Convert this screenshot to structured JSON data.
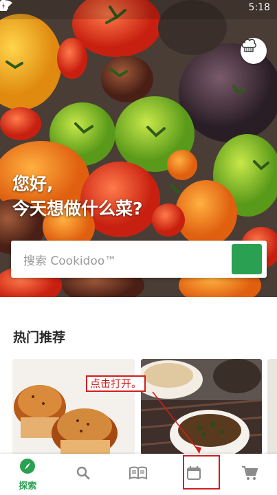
{
  "status_bar": {
    "time": "5:18"
  },
  "hero": {
    "greeting_line1": "您好,",
    "greeting_line2": "今天想做什么菜?"
  },
  "search": {
    "placeholder": "搜索 Cookidoo™"
  },
  "section": {
    "title": "热门推荐"
  },
  "annotation": {
    "label": "点击打开。"
  },
  "nav": {
    "explore_label": "探索",
    "active_color": "#2aa052",
    "icons": [
      "compass-icon",
      "search-icon",
      "book-icon",
      "calendar-icon",
      "cart-icon"
    ]
  },
  "colors": {
    "brand_green": "#2aa052",
    "annotation_red": "#d31d1d"
  }
}
